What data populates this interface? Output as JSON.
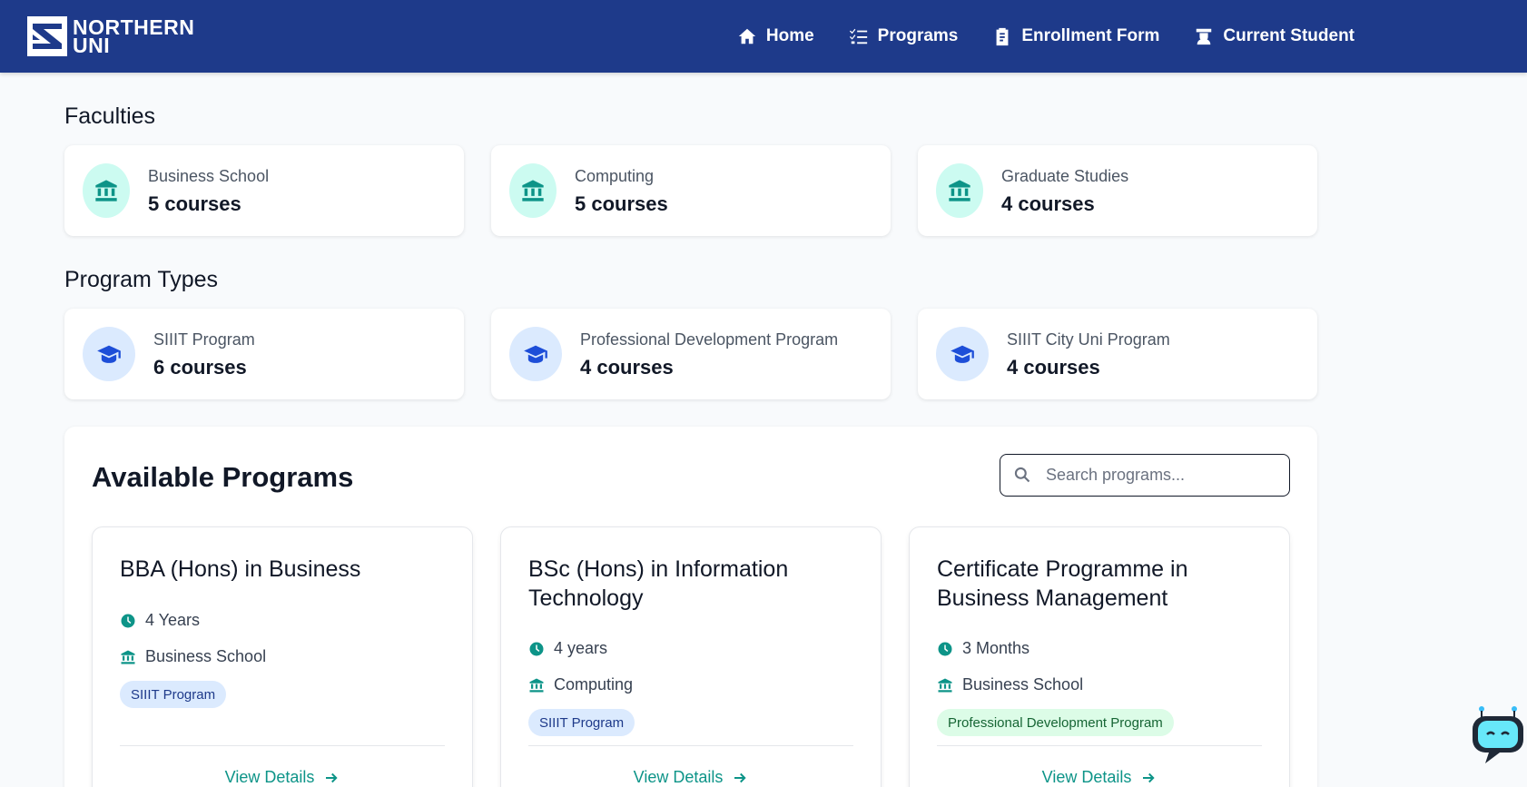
{
  "header": {
    "logo_line1": "NORTHERN",
    "logo_line2": "UNI",
    "nav": [
      {
        "label": "Home",
        "icon": "home-icon"
      },
      {
        "label": "Programs",
        "icon": "list-check-icon"
      },
      {
        "label": "Enrollment Form",
        "icon": "clipboard-icon"
      },
      {
        "label": "Current Student",
        "icon": "student-icon"
      }
    ]
  },
  "faculties": {
    "title": "Faculties",
    "items": [
      {
        "name": "Business School",
        "count": "5 courses"
      },
      {
        "name": "Computing",
        "count": "5 courses"
      },
      {
        "name": "Graduate Studies",
        "count": "4 courses"
      }
    ]
  },
  "program_types": {
    "title": "Program Types",
    "items": [
      {
        "name": "SIIIT Program",
        "count": "6 courses"
      },
      {
        "name": "Professional Development Program",
        "count": "4 courses"
      },
      {
        "name": "SIIIT City Uni Program",
        "count": "4 courses"
      }
    ]
  },
  "available": {
    "title": "Available Programs",
    "search_placeholder": "Search programs...",
    "programs": [
      {
        "title": "BBA (Hons) in Business",
        "duration": "4 Years",
        "faculty": "Business School",
        "type": "SIIIT Program",
        "link": "View Details"
      },
      {
        "title": "BSc (Hons) in Information Technology",
        "duration": "4 years",
        "faculty": "Computing",
        "type": "SIIIT Program",
        "link": "View Details"
      },
      {
        "title": "Certificate Programme in Business Management",
        "duration": "3 Months",
        "faculty": "Business School",
        "type": "Professional Development Program",
        "link": "View Details"
      }
    ]
  },
  "colors": {
    "header_bg": "#1e3a8a",
    "accent_teal": "#0d9488",
    "accent_blue": "#1d4ed8"
  }
}
